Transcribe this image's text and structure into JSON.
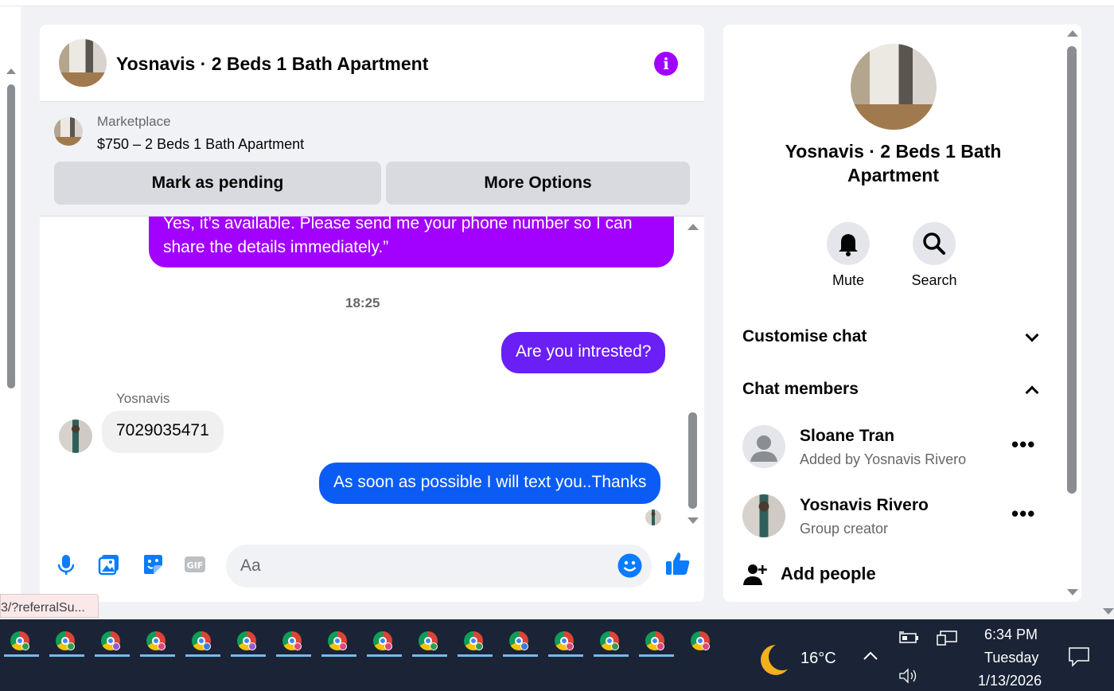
{
  "chat": {
    "title": "Yosnavis · 2 Beds 1 Bath Apartment",
    "marketplace_label": "Marketplace",
    "listing": "$750 – 2 Beds 1 Bath Apartment",
    "btn_pending": "Mark as pending",
    "btn_more": "More Options",
    "messages": {
      "m1": "Yes, it’s available. Please send me your phone number so I can share the details immediately.”",
      "timestamp": "18:25",
      "m2": "Are you intrested?",
      "sender": "Yosnavis",
      "m3": "7029035471",
      "m4": "As soon as possible I will text you..Thanks"
    },
    "composer_placeholder": "Aa"
  },
  "side": {
    "title": "Yosnavis · 2 Beds 1 Bath Apartment",
    "mute": "Mute",
    "search": "Search",
    "customise": "Customise chat",
    "members_label": "Chat members",
    "members": [
      {
        "name": "Sloane Tran",
        "sub": "Added by Yosnavis Rivero"
      },
      {
        "name": "Yosnavis Rivero",
        "sub": "Group creator"
      }
    ],
    "add_people": "Add people"
  },
  "status_url": "3/?referralSu...",
  "taskbar": {
    "temperature": "16°C",
    "time": "6:34 PM",
    "day": "Tuesday",
    "date": "1/13/2026"
  },
  "colors": {
    "purple": "#a200ff",
    "violet": "#6a1ff5",
    "blue": "#0a5cf5",
    "icon_blue": "#0a7cff"
  }
}
